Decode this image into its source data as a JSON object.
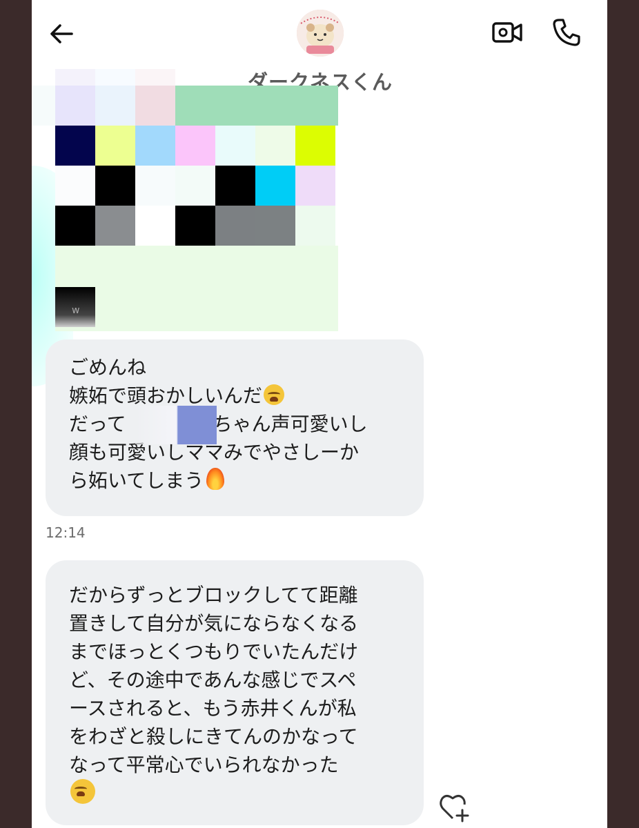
{
  "header": {
    "contact_name": "ダークネスくん",
    "icons": [
      "back-arrow-icon",
      "avatar",
      "video-call-icon",
      "phone-icon"
    ]
  },
  "messages": [
    {
      "lines": [
        "ごめんね",
        "嫉妬で頭おかしいんだ",
        "だって",
        "ちゃん声可愛いし",
        "顔も可愛いしママみでやさしーか",
        "ら妬いてしまう"
      ],
      "emojis": [
        "crying-face",
        "fire"
      ],
      "time": "12:14"
    },
    {
      "lines": [
        "だからずっとブロックしてて距離",
        "置きして自分が気にならなくなる",
        "までほっとくつもりでいたんだけ",
        "ど、その途中であんな感じでスペ",
        "ースされると、もう赤井くんが私",
        "をわざと殺しにきてんのかなって",
        "なって平常心でいられなかった"
      ],
      "emojis": [
        "crying-face"
      ]
    }
  ],
  "pixel_w": "w",
  "colors": {
    "bubble": "#eef0f2",
    "frame": "#3b2a2a",
    "name_text": "#5a5a5a"
  }
}
